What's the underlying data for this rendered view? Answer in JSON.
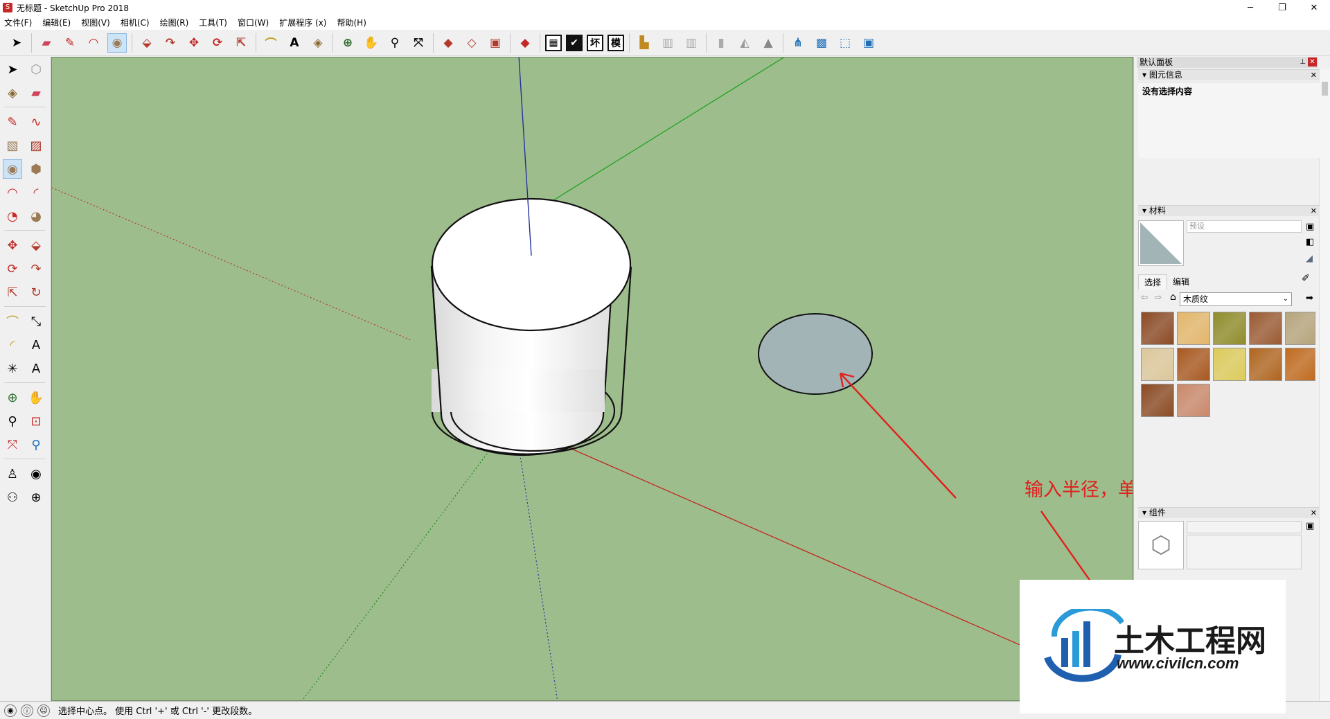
{
  "window": {
    "title": "无标题 - SketchUp Pro 2018",
    "minimize": "─",
    "restore": "❐",
    "close": "✕"
  },
  "menu": [
    "文件(F)",
    "编辑(E)",
    "视图(V)",
    "相机(C)",
    "绘图(R)",
    "工具(T)",
    "窗口(W)",
    "扩展程序 (x)",
    "帮助(H)"
  ],
  "toolbar": {
    "square_icons": [
      "",
      "",
      "坏",
      "模"
    ]
  },
  "viewport": {
    "annotation": "输入半径，单击确定",
    "annotation_color": "#e0201c",
    "background": "#9ebd8d",
    "circle_fill": "#a3b4b7"
  },
  "panel": {
    "title": "默认面板",
    "entity_info": {
      "header": "图元信息",
      "content": "没有选择内容"
    },
    "materials": {
      "header": "材料",
      "name_placeholder": "预设",
      "tabs": [
        "选择",
        "编辑"
      ],
      "library": "木质纹",
      "swatches": [
        "#8b4a25",
        "#e3b66a",
        "#8f8c2a",
        "#9a5a32",
        "#b6a47c",
        "#dcc79a",
        "#a8581f",
        "#dccb5a",
        "#b0651f",
        "#c06a1e",
        "#8a4a22",
        "#c9886a"
      ]
    },
    "components": {
      "header": "组件"
    }
  },
  "status": {
    "message": "选择中心点。 使用 Ctrl '+' 或 Ctrl '-' 更改段数。"
  },
  "watermark": {
    "cn": "土木工程网",
    "url": "www.civilcn.com"
  }
}
